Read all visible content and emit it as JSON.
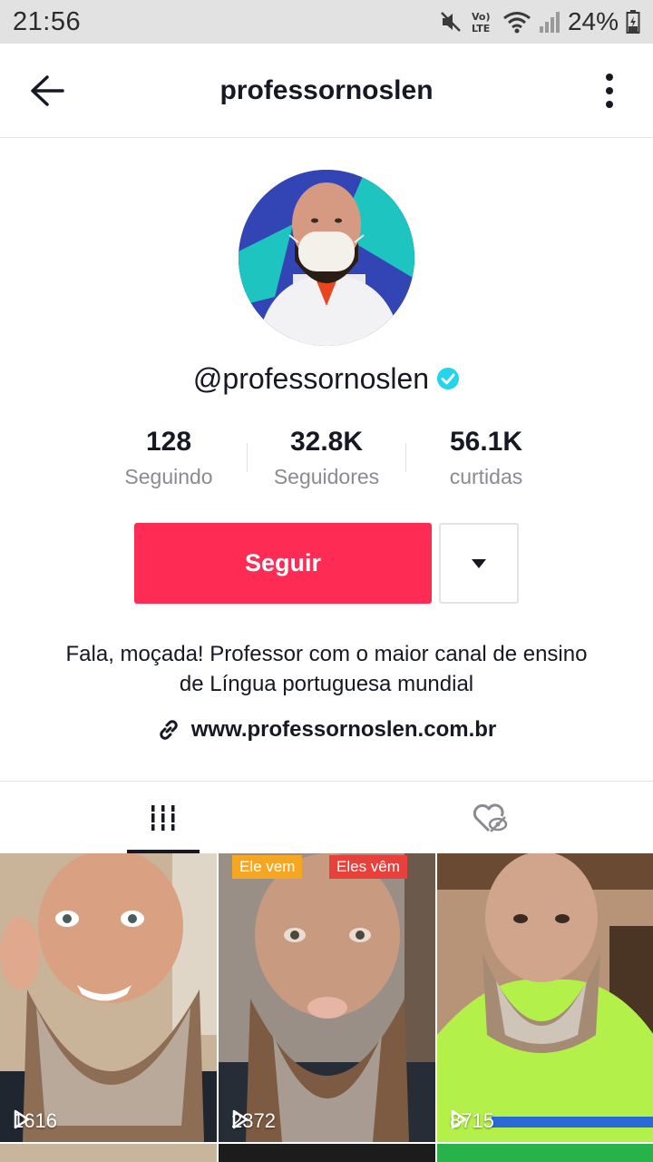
{
  "status_bar": {
    "time": "21:56",
    "battery": "24%",
    "icons": [
      "mute-icon",
      "volte-icon",
      "wifi-icon",
      "signal-icon",
      "battery-icon"
    ]
  },
  "header": {
    "title": "professornoslen",
    "back_icon": "back-arrow-icon",
    "more_icon": "more-vertical-icon"
  },
  "profile": {
    "username": "@professornoslen",
    "verified": true,
    "stats": [
      {
        "value": "128",
        "label": "Seguindo"
      },
      {
        "value": "32.8K",
        "label": "Seguidores"
      },
      {
        "value": "56.1K",
        "label": "curtidas"
      }
    ],
    "follow_label": "Seguir",
    "bio": "Fala, moçada! Professor com o maior canal de ensino de Língua portuguesa mundial",
    "link": "www.professornoslen.com.br"
  },
  "tabs": [
    {
      "name": "videos",
      "icon": "grid-icon",
      "active": true
    },
    {
      "name": "liked",
      "icon": "liked-hidden-icon",
      "active": false
    }
  ],
  "videos": [
    {
      "views": "1616",
      "tags": []
    },
    {
      "views": "2372",
      "tags": [
        "Ele vem",
        "Eles vêm"
      ]
    },
    {
      "views": "8715",
      "tags": []
    }
  ],
  "colors": {
    "accent": "#fe2c55",
    "verified": "#20d5ec",
    "tag_orange": "#f5a623",
    "tag_red": "#e8403a"
  }
}
